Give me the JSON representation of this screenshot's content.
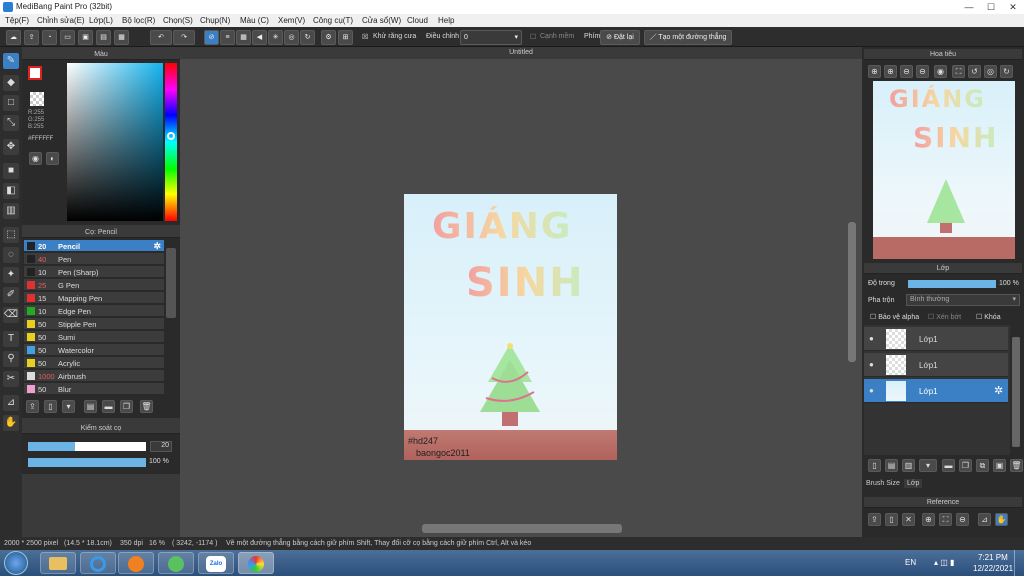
{
  "window": {
    "title": "MediBang Paint Pro (32bit)",
    "minimize": "—",
    "maximize": "☐",
    "close": "✕"
  },
  "menu": [
    "Tệp(F)",
    "Chỉnh sửa(E)",
    "Lớp(L)",
    "Bộ lọc(R)",
    "Chọn(S)",
    "Chụp(N)",
    "Màu (C)",
    "Xem(V)",
    "Công cụ(T)",
    "Cửa sổ(W)",
    "Cloud",
    "Help"
  ],
  "toolbar": {
    "antialias_label": "Khử răng cưa",
    "adjust_label": "Điều chỉnh",
    "adjust_value": "0",
    "sharp_edge_label": "Cạnh mềm",
    "key_label": "Phím",
    "reset_label": "Đặt lại",
    "straight_line_label": "Tạo một đường thẳng"
  },
  "color_panel": {
    "title": "Màu",
    "r": "R:255",
    "g": "G:255",
    "b": "B:255",
    "hex": "#FFFFFF"
  },
  "brush_panel": {
    "title": "Cọ: Pencil",
    "items": [
      {
        "size": "20",
        "name": "Pencil",
        "color": "#222222"
      },
      {
        "size": "40",
        "name": "Pen",
        "color": "#222222"
      },
      {
        "size": "10",
        "name": "Pen (Sharp)",
        "color": "#222222"
      },
      {
        "size": "25",
        "name": "G Pen",
        "color": "#e03030"
      },
      {
        "size": "15",
        "name": "Mapping Pen",
        "color": "#e03030"
      },
      {
        "size": "10",
        "name": "Edge Pen",
        "color": "#22aa22"
      },
      {
        "size": "50",
        "name": "Stipple Pen",
        "color": "#e8d020"
      },
      {
        "size": "50",
        "name": "Sumi",
        "color": "#e8d020"
      },
      {
        "size": "50",
        "name": "Watercolor",
        "color": "#40a0e0"
      },
      {
        "size": "50",
        "name": "Acrylic",
        "color": "#e8d020"
      },
      {
        "size": "1000",
        "name": "Airbrush",
        "color": "#dddddd"
      },
      {
        "size": "50",
        "name": "Blur",
        "color": "#f0a0d0"
      }
    ]
  },
  "control_panel": {
    "title": "Kiểm soát cọ",
    "size_value": "20",
    "opacity_value": "100 %",
    "size_fraction": 0.4,
    "opacity_fraction": 1.0
  },
  "canvas": {
    "tab": "Untitled",
    "art_line1": "GIÁNG",
    "art_line2": "SINH",
    "tag": "#hd247",
    "author": "baongoc2011"
  },
  "navigator": {
    "title": "Hoa tiêu",
    "art_line1": "GIÁNG",
    "art_line2": "SINH"
  },
  "layer_panel": {
    "title": "Lớp",
    "opacity_label": "Độ trong",
    "opacity_value": "100 %",
    "blend_label": "Pha trộn",
    "blend_value": "Bình thường",
    "protect_alpha": "Bảo vệ alpha",
    "clipping": "Xén bớt",
    "lock": "Khóa",
    "layers": [
      "Lớp1",
      "Lớp1",
      "Lớp1"
    ],
    "tab_brush_size": "Brush Size",
    "tab_layer": "Lớp"
  },
  "reference_panel": {
    "title": "Reference"
  },
  "status": {
    "dims": "2000 * 2500 pixel",
    "size_cm": "(14.5 * 18.1cm)",
    "dpi": "350 dpi",
    "zoom": "16 %",
    "coords": "( 3242, -1174 )",
    "hint": "Vẽ một đường thẳng bằng cách giữ phím Shift, Thay đổi cỡ cọ bằng cách giữ phím Ctrl, Alt và kéo"
  },
  "taskbar": {
    "lang": "EN",
    "time": "7:21 PM",
    "date": "12/22/2021",
    "zalo": "Zalo"
  }
}
